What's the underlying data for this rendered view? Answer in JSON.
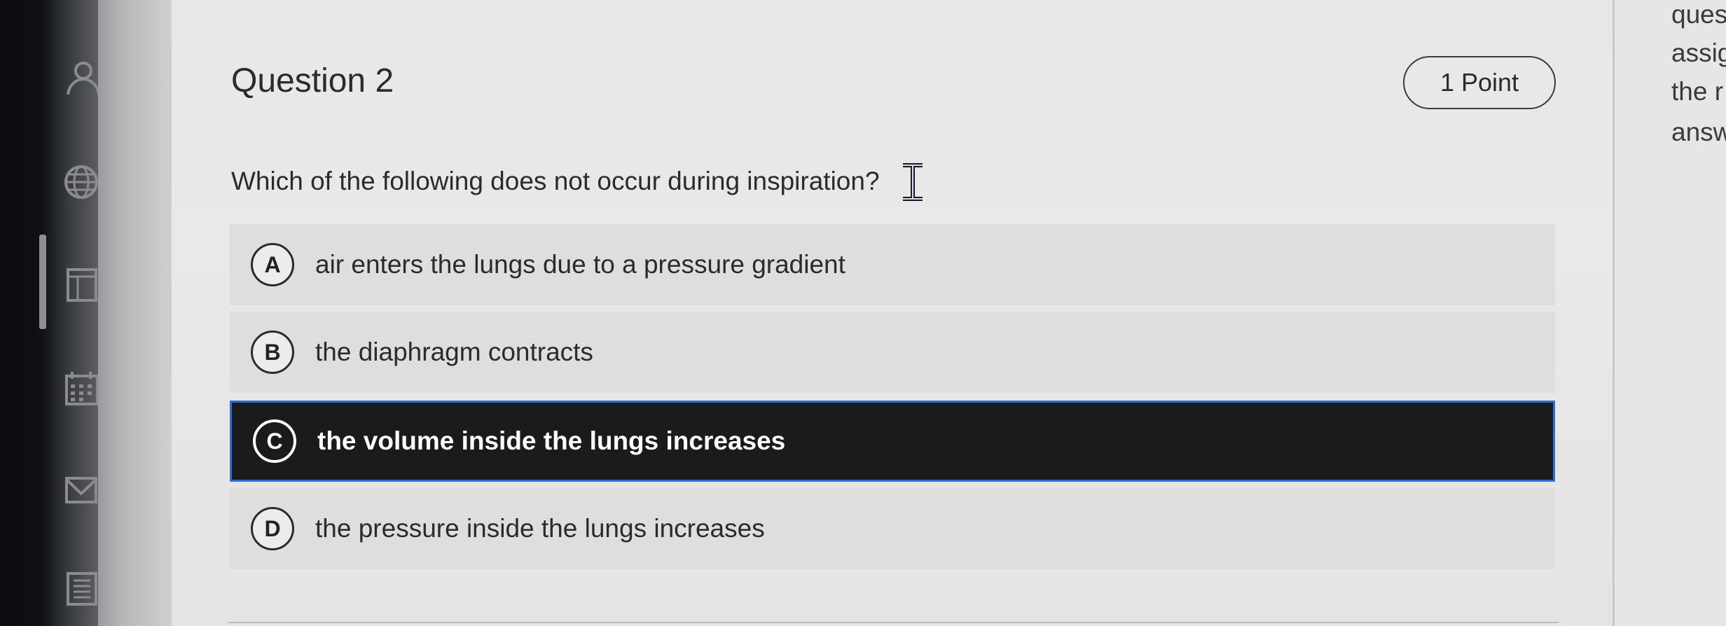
{
  "nav_rail": {
    "icons": [
      "user-icon",
      "globe-icon",
      "page-layout-icon",
      "calendar-icon",
      "inbox-icon",
      "history-icon"
    ]
  },
  "question": {
    "title": "Question 2",
    "points": "1 Point",
    "prompt": "Which of the following does not occur during inspiration?",
    "selected": "C",
    "options": [
      {
        "letter": "A",
        "text": "air enters the lungs due to a pressure gradient"
      },
      {
        "letter": "B",
        "text": "the diaphragm contracts"
      },
      {
        "letter": "C",
        "text": "the volume inside the lungs increases"
      },
      {
        "letter": "D",
        "text": "the pressure inside the lungs increases"
      }
    ]
  },
  "side_panel": {
    "lines": [
      "ques",
      "assig",
      "the r",
      "answ"
    ]
  },
  "colors": {
    "selected_bg": "#1a1b1d",
    "selected_border": "#2e6fd0",
    "option_bg": "#dedede",
    "text": "#2b2b2b"
  }
}
